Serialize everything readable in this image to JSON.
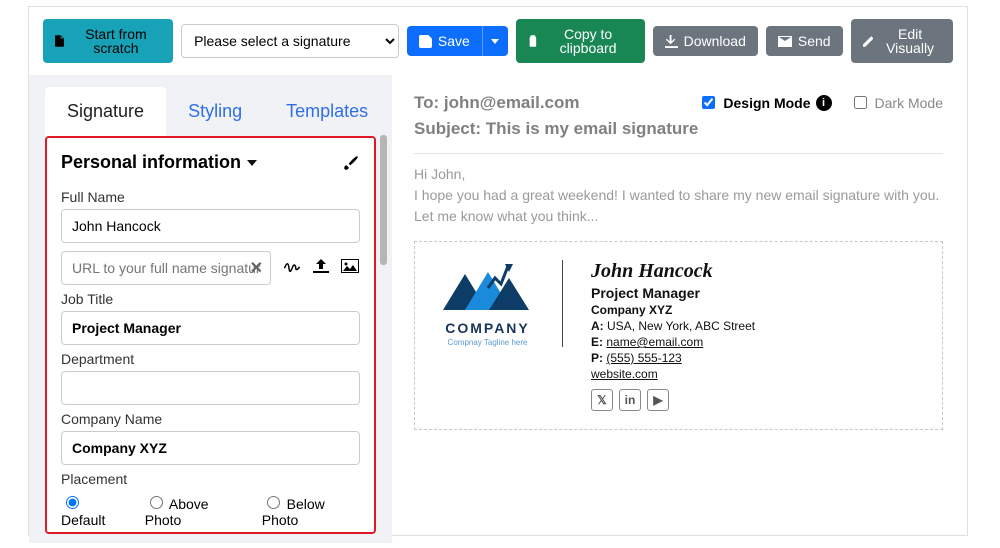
{
  "toolbar": {
    "start": "Start from scratch",
    "select_placeholder": "Please select a signature",
    "save": "Save",
    "copy": "Copy to clipboard",
    "download": "Download",
    "send": "Send",
    "edit": "Edit Visually"
  },
  "tabs": {
    "signature": "Signature",
    "styling": "Styling",
    "templates": "Templates"
  },
  "section": "Personal information",
  "fields": {
    "full_name_label": "Full Name",
    "full_name_value": "John Hancock",
    "url_placeholder": "URL to your full name signature",
    "job_label": "Job Title",
    "job_value": "Project Manager",
    "dept_label": "Department",
    "dept_value": "",
    "company_label": "Company Name",
    "company_value": "Company XYZ",
    "placement_label": "Placement",
    "placement_default": "Default",
    "placement_above": "Above Photo",
    "placement_below": "Below Photo"
  },
  "preview": {
    "to_prefix": "To: ",
    "to_value": "john@email.com",
    "subject_prefix": "Subject: ",
    "subject_value": "This is my email signature",
    "design_mode": "Design Mode",
    "dark_mode": "Dark Mode",
    "body_line1": "Hi John,",
    "body_line2": "I hope you had a great weekend! I wanted to share my new email signature with you.",
    "body_line3": "Let me know what you think...",
    "logo_brand": "COMPANY",
    "logo_tag": "Compnay Tagline here",
    "sig": {
      "name": "John Hancock",
      "job": "Project Manager",
      "company": "Company XYZ",
      "addr_label": "A:",
      "addr": "USA, New York, ABC Street",
      "email_label": "E:",
      "email": "name@email.com",
      "phone_label": "P:",
      "phone": "(555) 555-123",
      "site": "website.com"
    }
  }
}
